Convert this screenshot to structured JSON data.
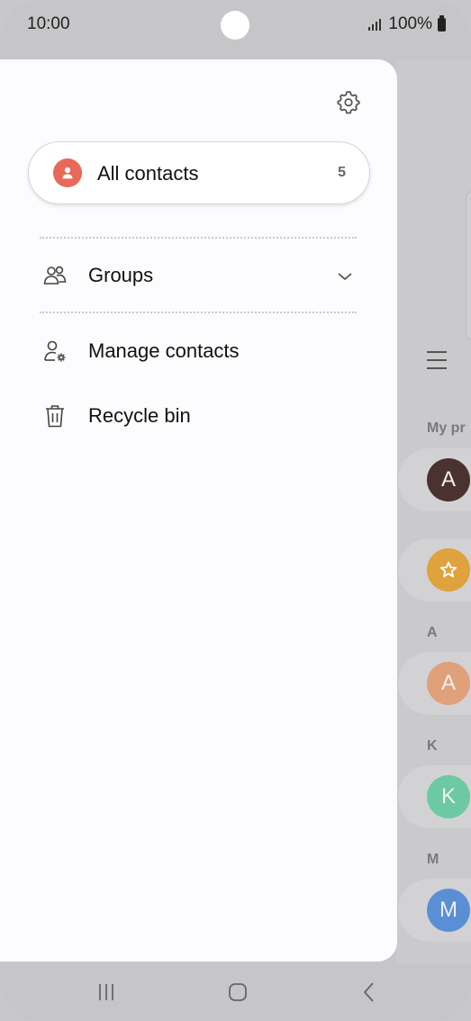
{
  "status_bar": {
    "time": "10:00",
    "battery_text": "100%"
  },
  "drawer": {
    "all_contacts": {
      "label": "All contacts",
      "count": "5"
    },
    "groups": {
      "label": "Groups"
    },
    "manage_contacts": {
      "label": "Manage contacts"
    },
    "recycle_bin": {
      "label": "Recycle bin"
    }
  },
  "background": {
    "sections": [
      "My pr",
      "A",
      "K",
      "M"
    ],
    "avatars": [
      {
        "letter": "A",
        "color": "#4a332e"
      },
      {
        "letter": "",
        "icon": "star-icon",
        "color": "#e0a23c"
      },
      {
        "letter": "A",
        "color": "#e0a07a"
      },
      {
        "letter": "K",
        "color": "#6cc9a2"
      },
      {
        "letter": "M",
        "color": "#5a8fd6"
      }
    ]
  },
  "colors": {
    "accent": "#e8685a",
    "drawer_bg": "#fcfbfe",
    "dim_bg": "#c6c6c8"
  }
}
